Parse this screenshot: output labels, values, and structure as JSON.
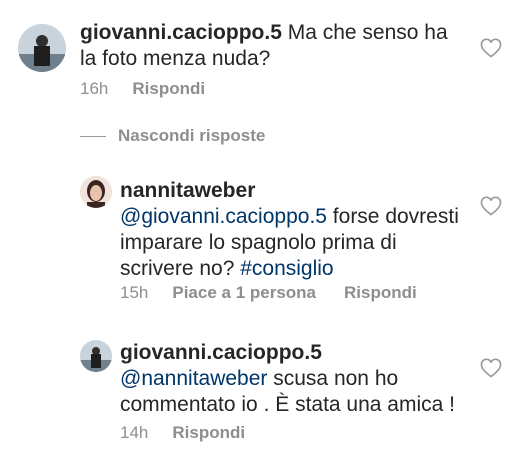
{
  "comments": [
    {
      "username": "giovanni.cacioppo.5",
      "text": " Ma che senso ha la foto menza nuda?",
      "time": "16h",
      "reply_label": "Rispondi"
    }
  ],
  "hide_replies_label": "Nascondi risposte",
  "replies": [
    {
      "username": "nannitaweber",
      "mention": "@giovanni.cacioppo.5",
      "text": " forse dovresti imparare lo spagnolo prima di scrivere no? ",
      "hashtag": "#consiglio",
      "time": "15h",
      "likes_label": "Piace a 1 persona",
      "reply_label": "Rispondi"
    },
    {
      "username": "giovanni.cacioppo.5",
      "mention": "@nannitaweber",
      "text": " scusa non ho commentato io . È stata una amica !",
      "time": "14h",
      "reply_label": "Rispondi"
    }
  ],
  "colors": {
    "text": "#262626",
    "secondary": "#8e8e8e",
    "link": "#003569"
  },
  "icons": [
    "avatar",
    "heart-icon"
  ]
}
